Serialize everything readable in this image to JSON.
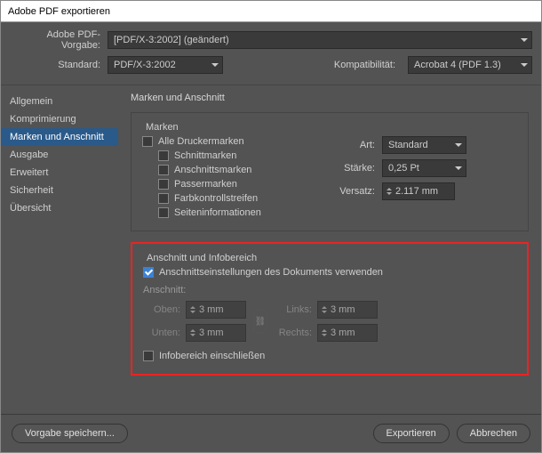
{
  "title": "Adobe PDF exportieren",
  "preset": {
    "label": "Adobe PDF-Vorgabe:",
    "value": "[PDF/X-3:2002] (geändert)"
  },
  "standard": {
    "label": "Standard:",
    "value": "PDF/X-3:2002"
  },
  "compat": {
    "label": "Kompatibilität:",
    "value": "Acrobat 4 (PDF 1.3)"
  },
  "sidebar": [
    "Allgemein",
    "Komprimierung",
    "Marken und Anschnitt",
    "Ausgabe",
    "Erweitert",
    "Sicherheit",
    "Übersicht"
  ],
  "page_heading": "Marken und Anschnitt",
  "marks": {
    "group": "Marken",
    "all": "Alle Druckermarken",
    "crop": "Schnittmarken",
    "bleedm": "Anschnittsmarken",
    "reg": "Passermarken",
    "color": "Farbkontrollstreifen",
    "page": "Seiteninformationen",
    "type_lbl": "Art:",
    "type_val": "Standard",
    "weight_lbl": "Stärke:",
    "weight_val": "0,25 Pt",
    "offset_lbl": "Versatz:",
    "offset_val": "2.117 mm"
  },
  "bleed": {
    "group": "Anschnitt und Infobereich",
    "use_doc": "Anschnittseinstellungen des Dokuments verwenden",
    "sub": "Anschnitt:",
    "top_lbl": "Oben:",
    "top_val": "3 mm",
    "bottom_lbl": "Unten:",
    "bottom_val": "3 mm",
    "left_lbl": "Links:",
    "left_val": "3 mm",
    "right_lbl": "Rechts:",
    "right_val": "3 mm",
    "slug": "Infobereich einschließen"
  },
  "footer": {
    "save": "Vorgabe speichern...",
    "export": "Exportieren",
    "cancel": "Abbrechen"
  }
}
